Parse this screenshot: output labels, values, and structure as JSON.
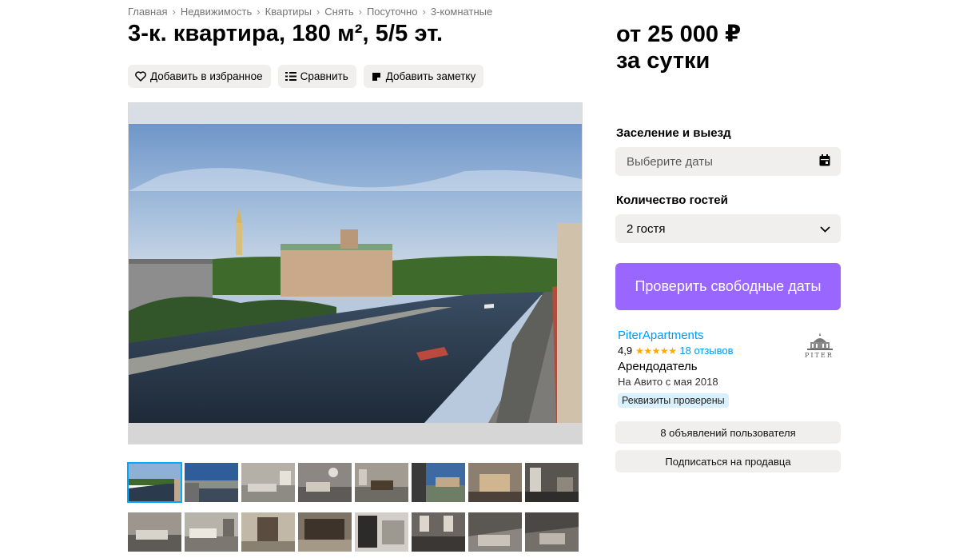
{
  "breadcrumbs": [
    "Главная",
    "Недвижимость",
    "Квартиры",
    "Снять",
    "Посуточно",
    "3-комнатные"
  ],
  "listing": {
    "title": "3-к. квартира, 180 м², 5/5 эт.",
    "price_line1": "от 25 000 ₽",
    "price_line2": "за сутки"
  },
  "actions": {
    "favorite_label": "Добавить в избранное",
    "compare_label": "Сравнить",
    "note_label": "Добавить заметку"
  },
  "booking": {
    "dates_label": "Заселение и выезд",
    "dates_placeholder": "Выберите даты",
    "guests_label": "Количество гостей",
    "guests_value": "2 гостя",
    "cta_label": "Проверить свободные даты"
  },
  "seller": {
    "name": "PiterApartments",
    "rating": "4,9",
    "stars": "★★★★★",
    "reviews": "18 отзывов",
    "role": "Арендодатель",
    "since": "На Авито с мая 2018",
    "badge": "Реквизиты проверены",
    "logo_text": "PITER",
    "listings_button": "8 объявлений пользователя",
    "subscribe_button": "Подписаться на продавца"
  },
  "gallery": {
    "thumbnail_count": 16,
    "active_index": 0
  },
  "colors": {
    "accent_purple": "#9966ff",
    "link_blue": "#0099f7",
    "star_orange": "#ffa800",
    "badge_bg": "#d9f0fd",
    "button_gray": "#f0efed"
  },
  "icons": [
    "heart-icon",
    "compare-icon",
    "note-icon",
    "calendar-icon",
    "chevron-down-icon",
    "chevron-right-icon"
  ]
}
